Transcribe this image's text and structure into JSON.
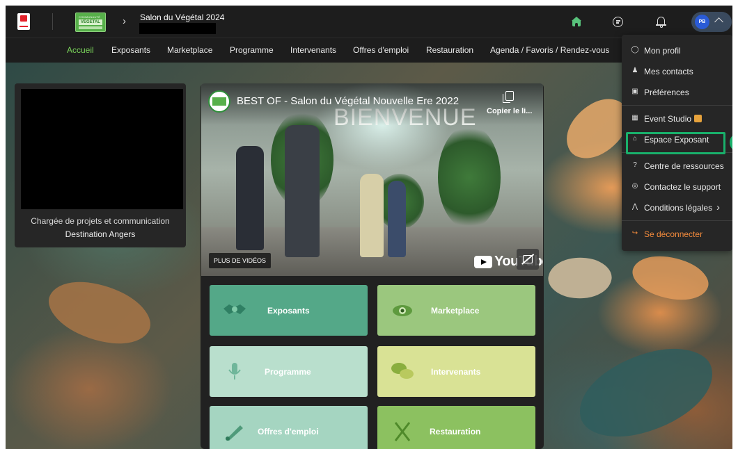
{
  "header": {
    "event_title": "Salon du Végétal 2024",
    "event_logo_top": "COMMUNAUTÉ",
    "event_logo_main": "VEGETAL",
    "user_initials": "PB"
  },
  "nav": {
    "items": [
      {
        "label": "Accueil",
        "active": true
      },
      {
        "label": "Exposants"
      },
      {
        "label": "Marketplace"
      },
      {
        "label": "Programme"
      },
      {
        "label": "Intervenants"
      },
      {
        "label": "Offres d'emploi"
      },
      {
        "label": "Restauration"
      },
      {
        "label": "Agenda / Favoris / Rendez-vous"
      }
    ]
  },
  "profile": {
    "role": "Chargée de projets et communication",
    "organization": "Destination Angers"
  },
  "video": {
    "title": "BEST OF - Salon du Végétal Nouvelle Ere 2022",
    "banner": "BIENVENUE",
    "copy_label": "Copier le li...",
    "more_videos": "PLUS DE VIDÉOS",
    "yt_word": "YouTube"
  },
  "tiles": [
    {
      "label": "Exposants"
    },
    {
      "label": "Marketplace"
    },
    {
      "label": "Programme"
    },
    {
      "label": "Intervenants"
    },
    {
      "label": "Offres d'emploi"
    },
    {
      "label": "Restauration"
    }
  ],
  "menu": {
    "items": [
      {
        "label": "Mon profil",
        "icon": "user-circle-icon"
      },
      {
        "label": "Mes contacts",
        "icon": "contacts-icon"
      },
      {
        "label": "Préférences",
        "icon": "preferences-icon"
      },
      {
        "label": "Event Studio",
        "icon": "calendar-icon"
      },
      {
        "label": "Espace Exposant",
        "icon": "booth-icon"
      },
      {
        "label": "Centre de ressources",
        "icon": "help-icon"
      },
      {
        "label": "Contactez le support",
        "icon": "support-icon"
      },
      {
        "label": "Conditions légales",
        "icon": "legal-icon"
      },
      {
        "label": "Se déconnecter",
        "icon": "logout-icon"
      }
    ]
  },
  "annotation": {
    "step": "2",
    "highlight_color": "#19b06b"
  },
  "colors": {
    "accent_green": "#7ad35a",
    "logout_orange": "#f28a3c"
  }
}
